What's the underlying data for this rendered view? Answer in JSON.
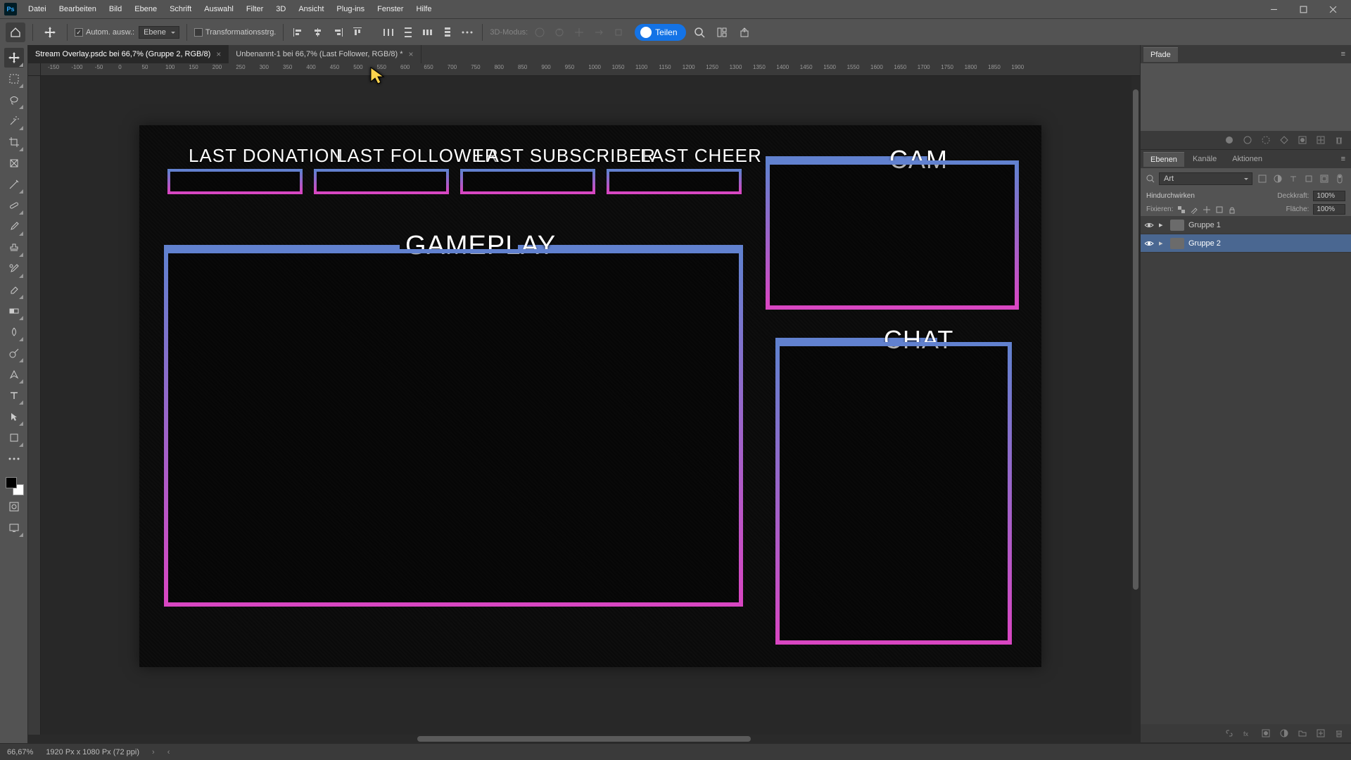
{
  "app": {
    "logo_text": "Ps"
  },
  "menu": {
    "items": [
      "Datei",
      "Bearbeiten",
      "Bild",
      "Ebene",
      "Schrift",
      "Auswahl",
      "Filter",
      "3D",
      "Ansicht",
      "Plug-ins",
      "Fenster",
      "Hilfe"
    ]
  },
  "options": {
    "auto_select": "Autom. ausw.:",
    "layer_dd": "Ebene",
    "transform": "Transformationsstrg.",
    "mode3d": "3D-Modus:",
    "share": "Teilen"
  },
  "tabs": [
    {
      "label": "Stream Overlay.psdc bei 66,7% (Gruppe 2, RGB/8)",
      "active": true
    },
    {
      "label": "Unbenannt-1 bei 66,7% (Last Follower, RGB/8) *",
      "active": false
    }
  ],
  "ruler": {
    "labels": [
      "-150",
      "-100",
      "-50",
      "0",
      "50",
      "100",
      "150",
      "200",
      "250",
      "300",
      "350",
      "400",
      "450",
      "500",
      "550",
      "600",
      "650",
      "700",
      "750",
      "800",
      "850",
      "900",
      "950",
      "1000",
      "1050",
      "1100",
      "1150",
      "1200",
      "1250",
      "1300",
      "1350",
      "1400",
      "1450",
      "1500",
      "1550",
      "1600",
      "1650",
      "1700",
      "1750",
      "1800",
      "1850",
      "1900"
    ]
  },
  "overlay": {
    "donation": "LAST DONATION",
    "follower": "LAST FOLLOWER",
    "subscriber": "LAST SUBSCRIBER",
    "cheer": "LAST CHEER",
    "gameplay": "GAMEPLAY",
    "cam": "CAM",
    "chat": "CHAT"
  },
  "panels": {
    "paths_tab": "Pfade",
    "layers_tab": "Ebenen",
    "channels_tab": "Kanäle",
    "actions_tab": "Aktionen",
    "filter_kind": "Art",
    "blend_mode": "Hindurchwirken",
    "opacity_label": "Deckkraft:",
    "opacity_value": "100%",
    "lock_label": "Fixieren:",
    "fill_label": "Fläche:",
    "fill_value": "100%",
    "layers": [
      {
        "name": "Gruppe 1",
        "selected": false
      },
      {
        "name": "Gruppe 2",
        "selected": true
      }
    ]
  },
  "status": {
    "zoom": "66,67%",
    "doc_info": "1920 Px x 1080 Px (72 ppi)"
  },
  "colors": {
    "accent_blue": "#6181cf",
    "accent_pink": "#d846c2",
    "share_blue": "#1473e6"
  }
}
